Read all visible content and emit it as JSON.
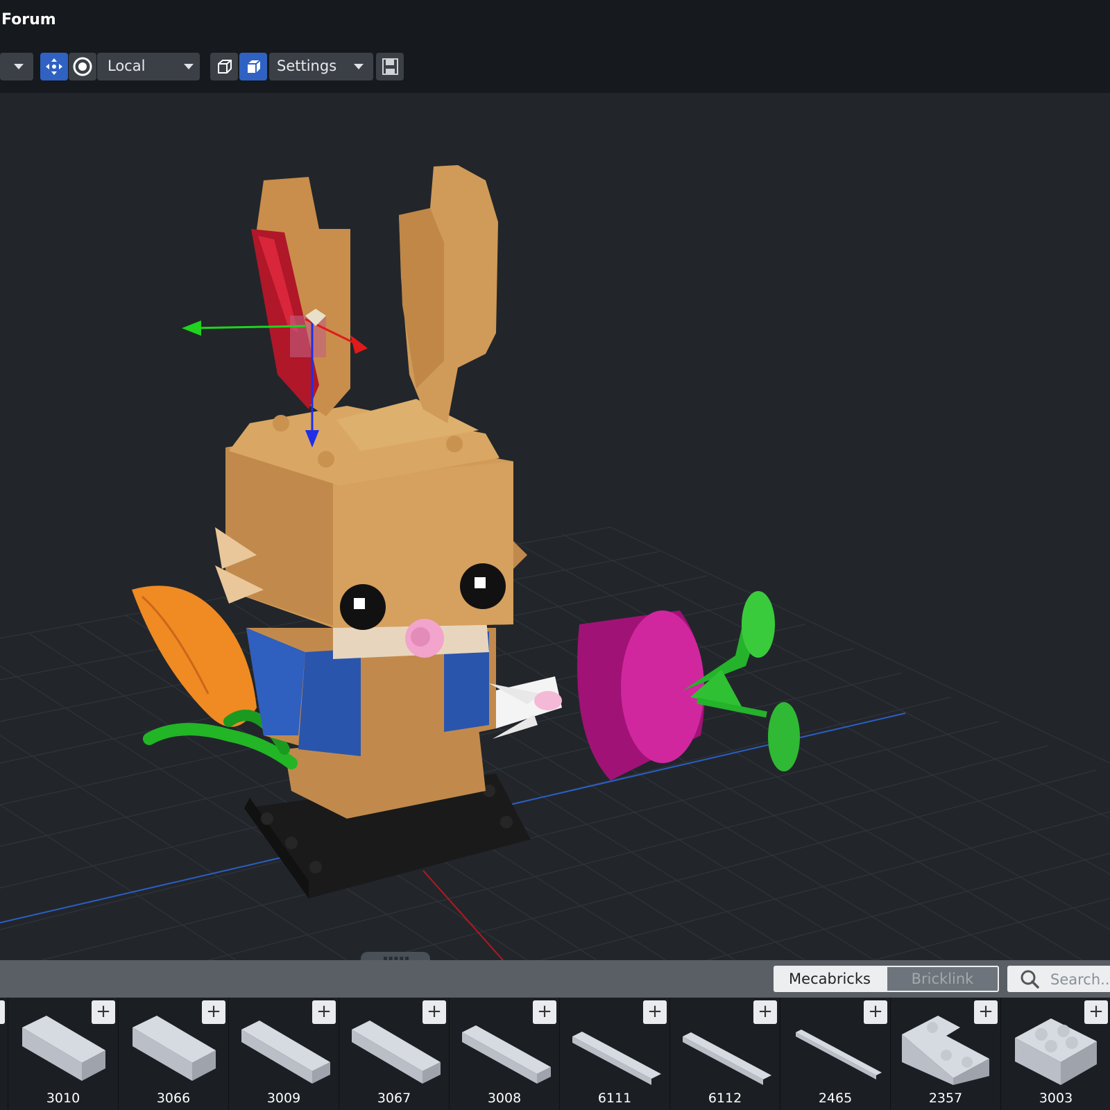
{
  "window": {
    "title": "Forum"
  },
  "toolbar": {
    "space_label": "Local",
    "settings_label": "Settings"
  },
  "parts_panel": {
    "tabs": [
      {
        "label": "Mecabricks",
        "selected": true
      },
      {
        "label": "Bricklink",
        "selected": false
      }
    ],
    "search_placeholder": "Search...",
    "add_label": "+",
    "parts": [
      {
        "id": "3010",
        "shape": "brick-1x4"
      },
      {
        "id": "3066",
        "shape": "brick-1x4"
      },
      {
        "id": "3009",
        "shape": "brick-1x6"
      },
      {
        "id": "3067",
        "shape": "brick-1x6"
      },
      {
        "id": "3008",
        "shape": "brick-1x8"
      },
      {
        "id": "6111",
        "shape": "brick-1x10"
      },
      {
        "id": "6112",
        "shape": "brick-1x12"
      },
      {
        "id": "2465",
        "shape": "brick-1x16"
      },
      {
        "id": "2357",
        "shape": "brick-corner-2x2x2"
      },
      {
        "id": "3003",
        "shape": "brick-2x2"
      }
    ]
  },
  "colors": {
    "accent": "#2f62c2",
    "gizmo_x": "#e01b1b",
    "gizmo_y": "#1fd31f",
    "gizmo_z": "#1f2ee8"
  }
}
